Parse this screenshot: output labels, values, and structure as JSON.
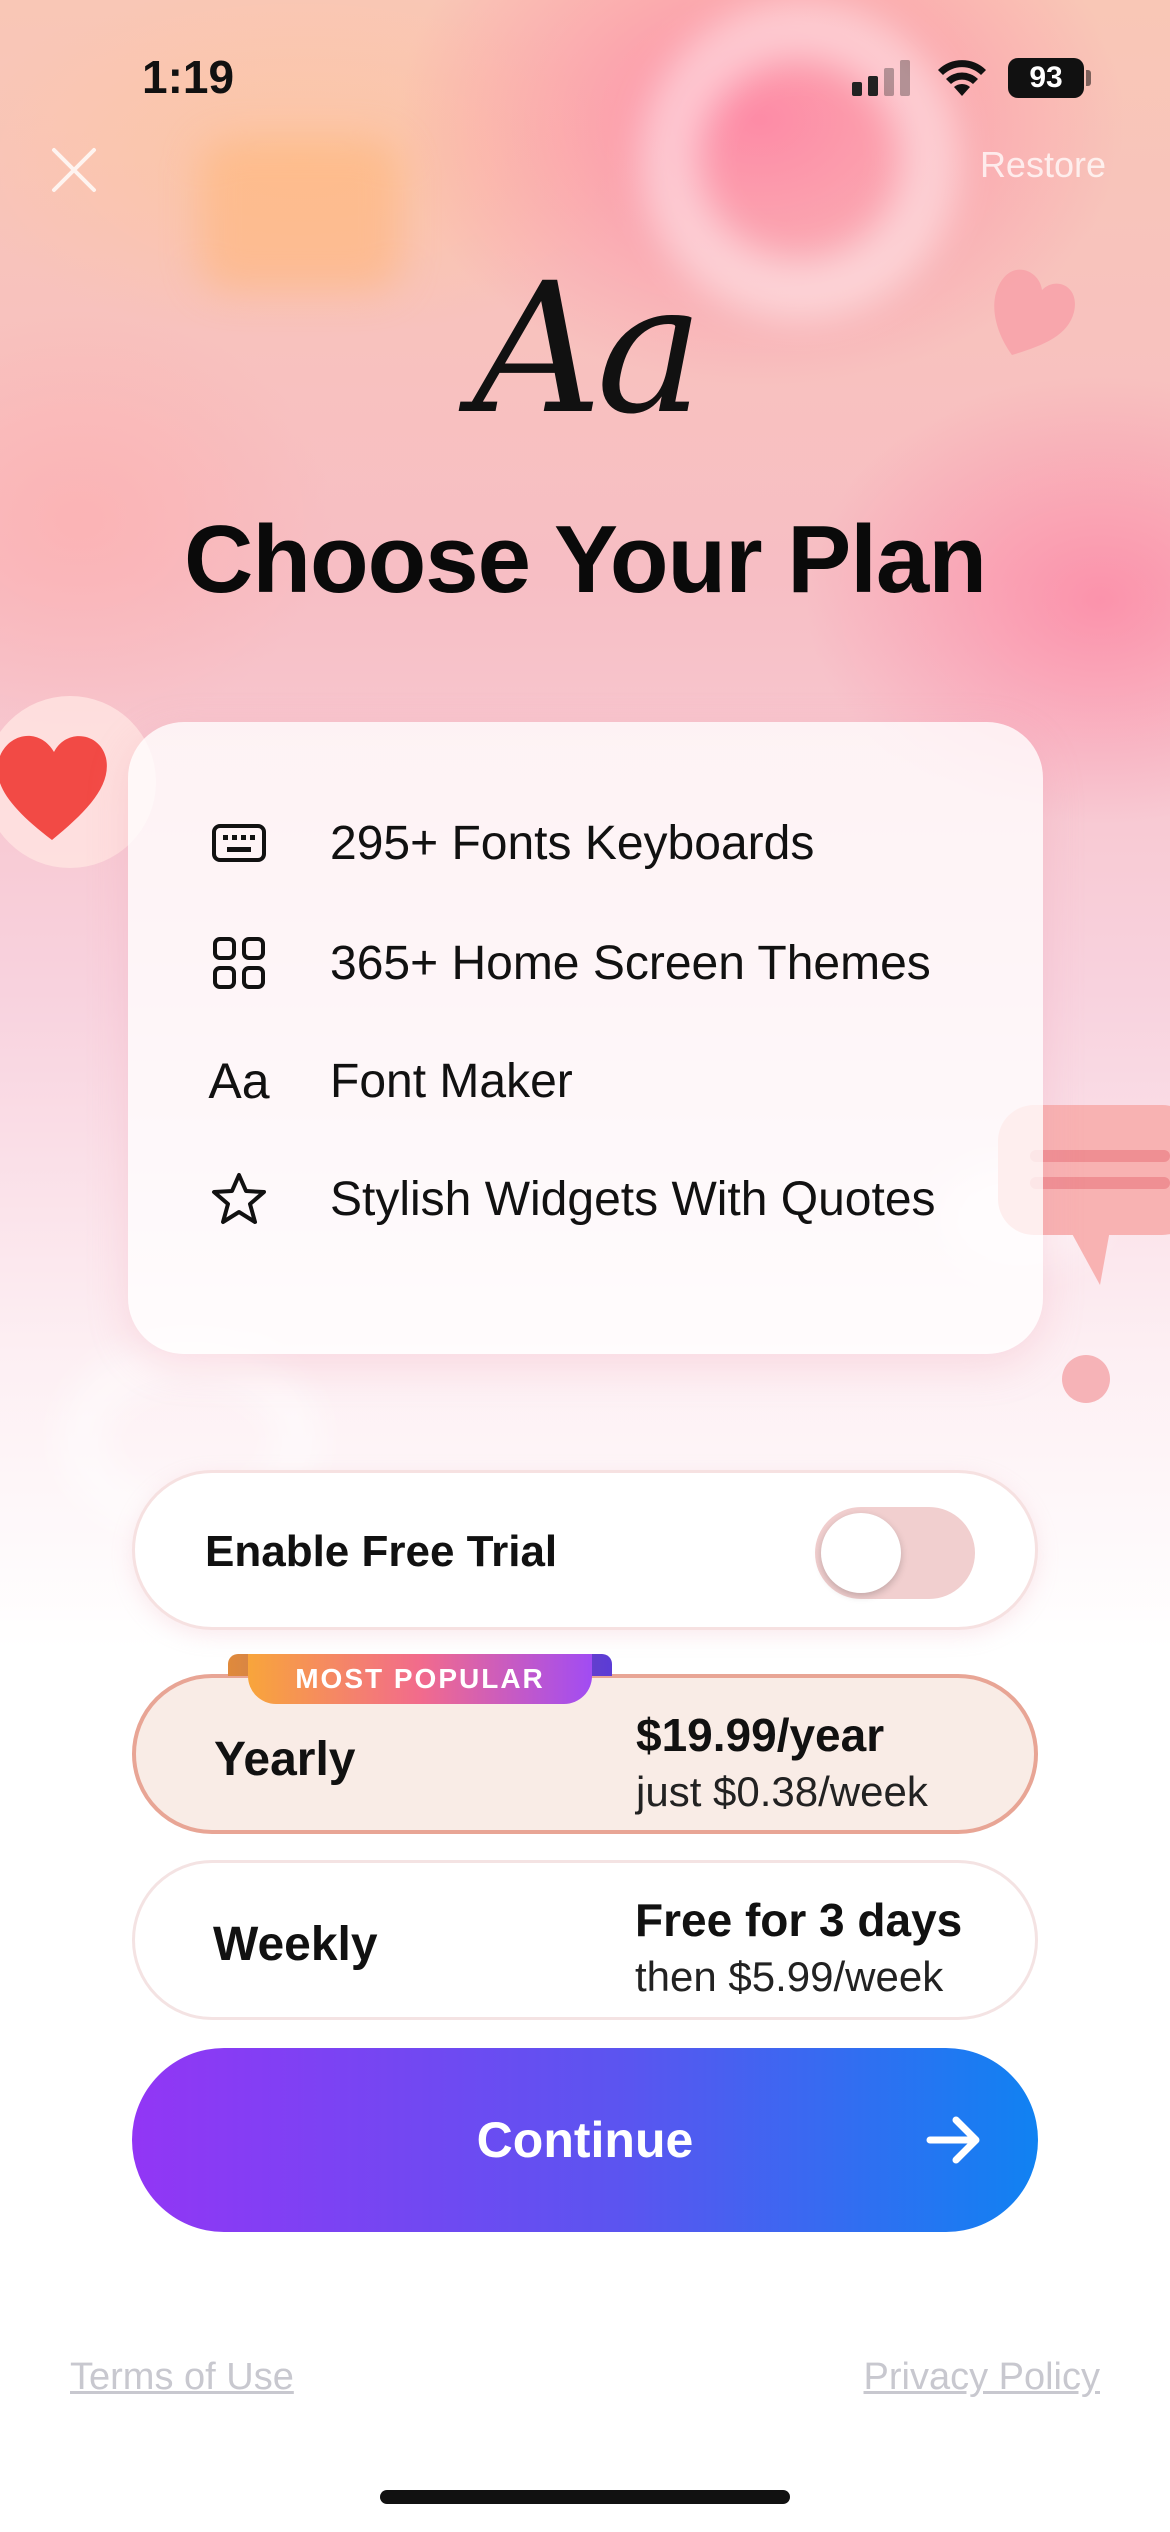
{
  "status_bar": {
    "time": "1:19",
    "battery": "93"
  },
  "header": {
    "restore_label": "Restore",
    "logo_text": "Aa",
    "title": "Choose Your Plan"
  },
  "features": [
    {
      "icon": "keyboard-icon",
      "label": "295+ Fonts Keyboards"
    },
    {
      "icon": "grid-icon",
      "label": "365+ Home Screen Themes"
    },
    {
      "icon": "font-aa-icon",
      "icon_text": "Aa",
      "label": "Font Maker"
    },
    {
      "icon": "star-icon",
      "label": "Stylish Widgets With Quotes"
    }
  ],
  "trial": {
    "label": "Enable Free Trial",
    "enabled": false
  },
  "plans": {
    "badge": "MOST POPULAR",
    "yearly": {
      "name": "Yearly",
      "price": "$19.99/year",
      "sub": "just $0.38/week",
      "selected": true
    },
    "weekly": {
      "name": "Weekly",
      "price": "Free for 3 days",
      "sub": "then $5.99/week",
      "selected": false
    }
  },
  "continue_label": "Continue",
  "footer": {
    "terms": "Terms of Use",
    "privacy": "Privacy Policy"
  },
  "colors": {
    "accent_start": "#9236f5",
    "accent_end": "#1082f2",
    "selected_border": "#e8a595"
  }
}
